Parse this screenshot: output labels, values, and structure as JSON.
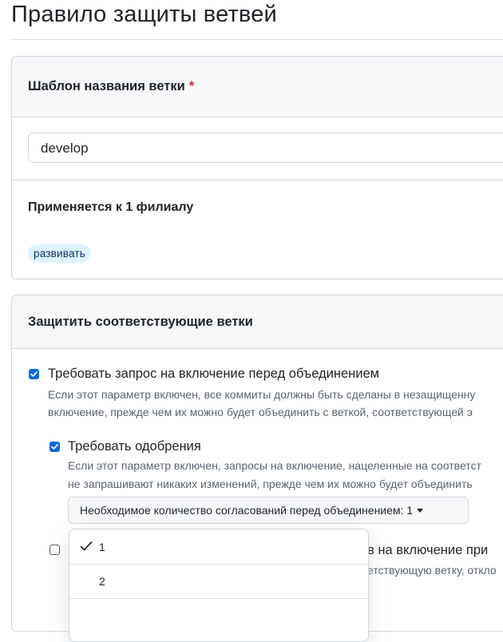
{
  "page": {
    "title": "Правило защиты ветвей"
  },
  "pattern_section": {
    "label": "Шаблон названия ветки",
    "required_mark": "*",
    "input_value": "develop",
    "applies_to": "Применяется к 1 филиалу",
    "matched_branch": "развивать"
  },
  "protect_section": {
    "heading": "Защитить соответствующие ветки",
    "require_pr": {
      "checked": true,
      "label": "Требовать запрос на включение перед объединением",
      "desc_line1": "Если этот параметр включен, все коммиты должны быть сделаны в незащищенну",
      "desc_line2": "включение, прежде чем их можно будет объединить с веткой, соответствующей э"
    },
    "require_approvals": {
      "checked": true,
      "label": "Требовать одобрения",
      "desc_line1": "Если этот параметр включен, запросы на включение, нацеленные на соответст",
      "desc_line2": "не запрашивают никаких изменений, прежде чем их можно будет объединить",
      "select_label": "Необходимое количество согласований перед объединением: 1"
    },
    "hidden_option": {
      "checked": false,
      "label_fragment": "в на включение при",
      "desc_fragment": "етствующую ветку, откло"
    }
  },
  "approvals_menu": {
    "selected": "1",
    "options": [
      "1",
      "2"
    ]
  },
  "colors": {
    "accent": "#0969da",
    "required": "#cf222e",
    "label_bg": "#ddf4ff"
  },
  "icons": {
    "check": "check-icon",
    "caret": "caret-down-icon"
  }
}
